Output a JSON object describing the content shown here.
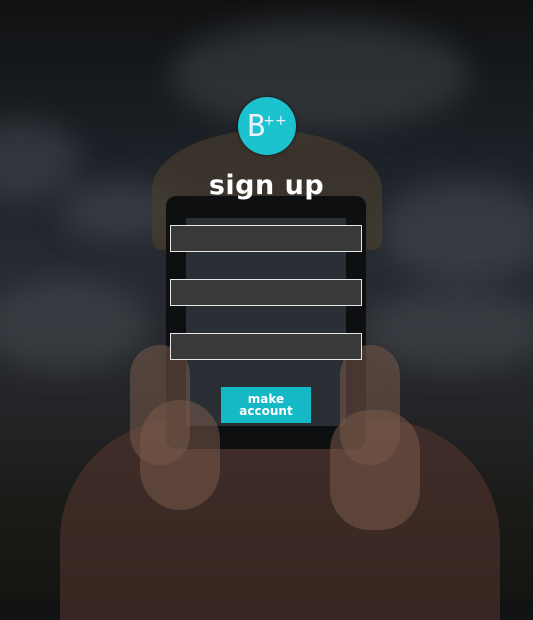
{
  "logo": {
    "text": "B++",
    "color": "#1bc3cf"
  },
  "title": "sign up",
  "fields": [
    {
      "value": "",
      "placeholder": ""
    },
    {
      "value": "",
      "placeholder": ""
    },
    {
      "value": "",
      "placeholder": ""
    }
  ],
  "submit": {
    "label_line1": "make",
    "label_line2": "account",
    "color": "#15b9c6"
  }
}
